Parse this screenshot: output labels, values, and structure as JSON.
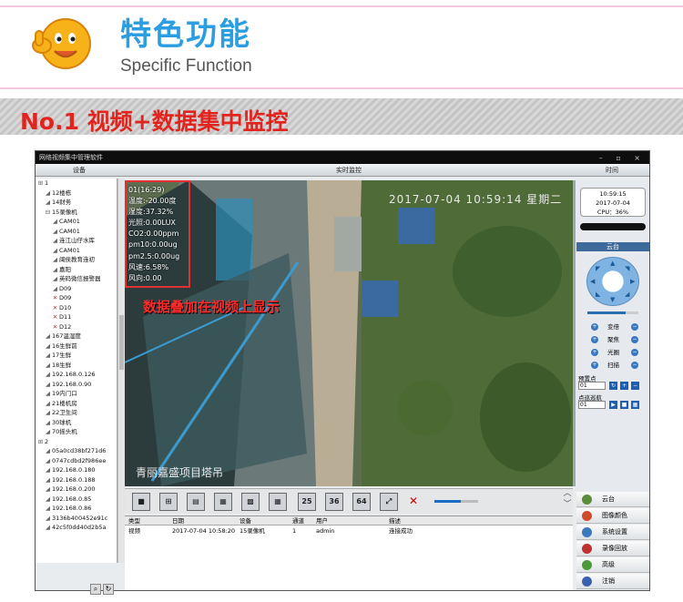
{
  "header": {
    "title_cn": "特色功能",
    "title_en": "Specific Function"
  },
  "banner": {
    "text": "No.1 视频+数据集中监控"
  },
  "app": {
    "window_title": "网络视频集中管理软件",
    "window_buttons": "– ▫ ×",
    "col_device": "设备",
    "col_live": "实时监控",
    "col_time": "时间",
    "tree": [
      {
        "icon": "root",
        "label": "1",
        "indent": 0
      },
      {
        "icon": "cam",
        "label": "12楼栋",
        "indent": 1
      },
      {
        "icon": "cam",
        "label": "14财务",
        "indent": 1
      },
      {
        "icon": "expand",
        "label": "15录像机",
        "indent": 1
      },
      {
        "icon": "cam",
        "label": "CAM01",
        "indent": 2
      },
      {
        "icon": "cam",
        "label": "CAM01",
        "indent": 2
      },
      {
        "icon": "cam",
        "label": "连江山仔水库",
        "indent": 2
      },
      {
        "icon": "cam",
        "label": "CAM01",
        "indent": 2
      },
      {
        "icon": "cam",
        "label": "闽侯教育连初",
        "indent": 2
      },
      {
        "icon": "cam",
        "label": "嘉阳",
        "indent": 2
      },
      {
        "icon": "cam",
        "label": "英码微信报警器",
        "indent": 2
      },
      {
        "icon": "cam",
        "label": "D09",
        "indent": 2
      },
      {
        "icon": "x",
        "label": "D09",
        "indent": 2
      },
      {
        "icon": "x",
        "label": "D10",
        "indent": 2
      },
      {
        "icon": "x",
        "label": "D11",
        "indent": 2
      },
      {
        "icon": "x",
        "label": "D12",
        "indent": 2
      },
      {
        "icon": "cam",
        "label": "167温湿度",
        "indent": 1
      },
      {
        "icon": "cam",
        "label": "16生鲜前",
        "indent": 1
      },
      {
        "icon": "cam",
        "label": "17生鲜",
        "indent": 1
      },
      {
        "icon": "cam",
        "label": "18生鲜",
        "indent": 1
      },
      {
        "icon": "cam",
        "label": "192.168.0.126",
        "indent": 1
      },
      {
        "icon": "cam",
        "label": "192.168.0.90",
        "indent": 1
      },
      {
        "icon": "cam",
        "label": "19内门口",
        "indent": 1
      },
      {
        "icon": "cam",
        "label": "21楼机房",
        "indent": 1
      },
      {
        "icon": "cam",
        "label": "22卫生间",
        "indent": 1
      },
      {
        "icon": "cam",
        "label": "30球机",
        "indent": 1
      },
      {
        "icon": "cam",
        "label": "70摇头机",
        "indent": 1
      },
      {
        "icon": "root",
        "label": "2",
        "indent": 0
      },
      {
        "icon": "cam",
        "label": "05a0cd38bf271d6",
        "indent": 1
      },
      {
        "icon": "cam",
        "label": "0747cdbd2f986ee",
        "indent": 1
      },
      {
        "icon": "cam",
        "label": "192.168.0.180",
        "indent": 1
      },
      {
        "icon": "cam",
        "label": "192.168.0.188",
        "indent": 1
      },
      {
        "icon": "cam",
        "label": "192.168.0.200",
        "indent": 1
      },
      {
        "icon": "cam",
        "label": "192.168.0.85",
        "indent": 1
      },
      {
        "icon": "cam",
        "label": "192.168.0.86",
        "indent": 1
      },
      {
        "icon": "cam",
        "label": "3136b400452e91c",
        "indent": 1
      },
      {
        "icon": "cam",
        "label": "42c5f0dd40d2b5a",
        "indent": 1
      }
    ],
    "overlay_lines": [
      "01(16:29)",
      "温度:-20.00度",
      "湿度:37.32%",
      "光照:0.00LUX",
      "CO2:0.00ppm",
      "pm10:0.00ug",
      "pm2.5:0.00ug",
      "风速:6.58%",
      "风向:0.00"
    ],
    "video_timestamp": "2017-07-04 10:59:14 星期二",
    "video_caption": "青丽嘉盛项目塔吊",
    "annotation": "数据叠加在视频上显示",
    "clock": {
      "time": "10:59:15",
      "date": "2017-07-04",
      "cpu": "CPU：36%"
    },
    "ptz_title": "云台",
    "ptz_controls": [
      "变倍",
      "聚焦",
      "光圈",
      "扫描"
    ],
    "preset_label": "预置点",
    "cruise_label": "点巡巡航",
    "select_value": "01",
    "layout_buttons": [
      "25",
      "36",
      "64"
    ],
    "log_headers": [
      "类型",
      "日期",
      "设备",
      "通道",
      "用户",
      "描述"
    ],
    "log_rows": [
      [
        "视频",
        "2017-07-04 10:58:20",
        "15录像机",
        "1",
        "admin",
        "连接成功"
      ]
    ],
    "nav": [
      "云台",
      "图像颜色",
      "系统设置",
      "录像回放",
      "高级",
      "注销"
    ]
  }
}
